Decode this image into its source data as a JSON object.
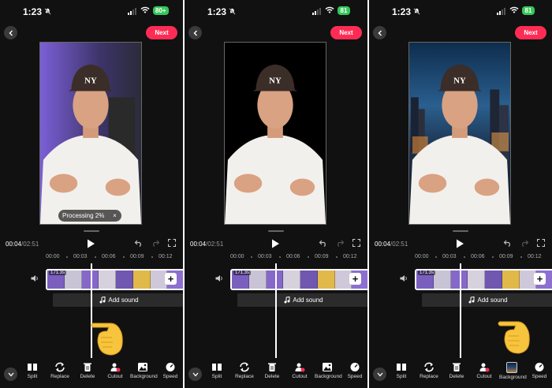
{
  "panels": [
    {
      "status": {
        "time": "1:23",
        "battery": "80+"
      },
      "header": {
        "next_label": "Next"
      },
      "preview": {
        "background": "purple-room",
        "processing_text": "Processing 2%",
        "processing_close": "×"
      },
      "controls": {
        "position": "00:04",
        "duration": "/02:51"
      },
      "timeline": {
        "ticks": [
          "00:00",
          "00:03",
          "00:06",
          "00:09",
          "00:12"
        ],
        "clip_tag": "171.3s",
        "add_sound_label": "Add sound"
      },
      "toolbar": {
        "items": [
          "Split",
          "Replace",
          "Delete",
          "Cutout",
          "Background",
          "Speed"
        ]
      }
    },
    {
      "status": {
        "time": "1:23",
        "battery": "81"
      },
      "header": {
        "next_label": "Next"
      },
      "preview": {
        "background": "black"
      },
      "controls": {
        "position": "00:04",
        "duration": "/02:51"
      },
      "timeline": {
        "ticks": [
          "00:00",
          "00:03",
          "00:06",
          "00:09",
          "00:12"
        ],
        "clip_tag": "171.3s",
        "add_sound_label": "Add sound"
      },
      "toolbar": {
        "items": [
          "Split",
          "Replace",
          "Delete",
          "Cutout",
          "Background",
          "Speed"
        ]
      }
    },
    {
      "status": {
        "time": "1:23",
        "battery": "81"
      },
      "header": {
        "next_label": "Next"
      },
      "preview": {
        "background": "night-city"
      },
      "controls": {
        "position": "00:04",
        "duration": "/02:51"
      },
      "timeline": {
        "ticks": [
          "00:00",
          "00:03",
          "00:06",
          "00:09",
          "00:12"
        ],
        "clip_tag": "171.3s",
        "add_sound_label": "Add sound"
      },
      "toolbar": {
        "items": [
          "Split",
          "Replace",
          "Delete",
          "Cutout",
          "Background",
          "Speed"
        ]
      }
    }
  ],
  "colors": {
    "accent": "#fe2c55",
    "battery": "#34c759",
    "panel_bg": "#111111"
  },
  "icons": [
    "back-arrow-icon",
    "play-icon",
    "undo-icon",
    "redo-icon",
    "fullscreen-icon",
    "volume-icon",
    "music-note-icon",
    "split-icon",
    "replace-icon",
    "trash-icon",
    "cutout-icon",
    "background-icon",
    "speed-icon",
    "chevron-down-icon",
    "pointing-hand-icon"
  ]
}
